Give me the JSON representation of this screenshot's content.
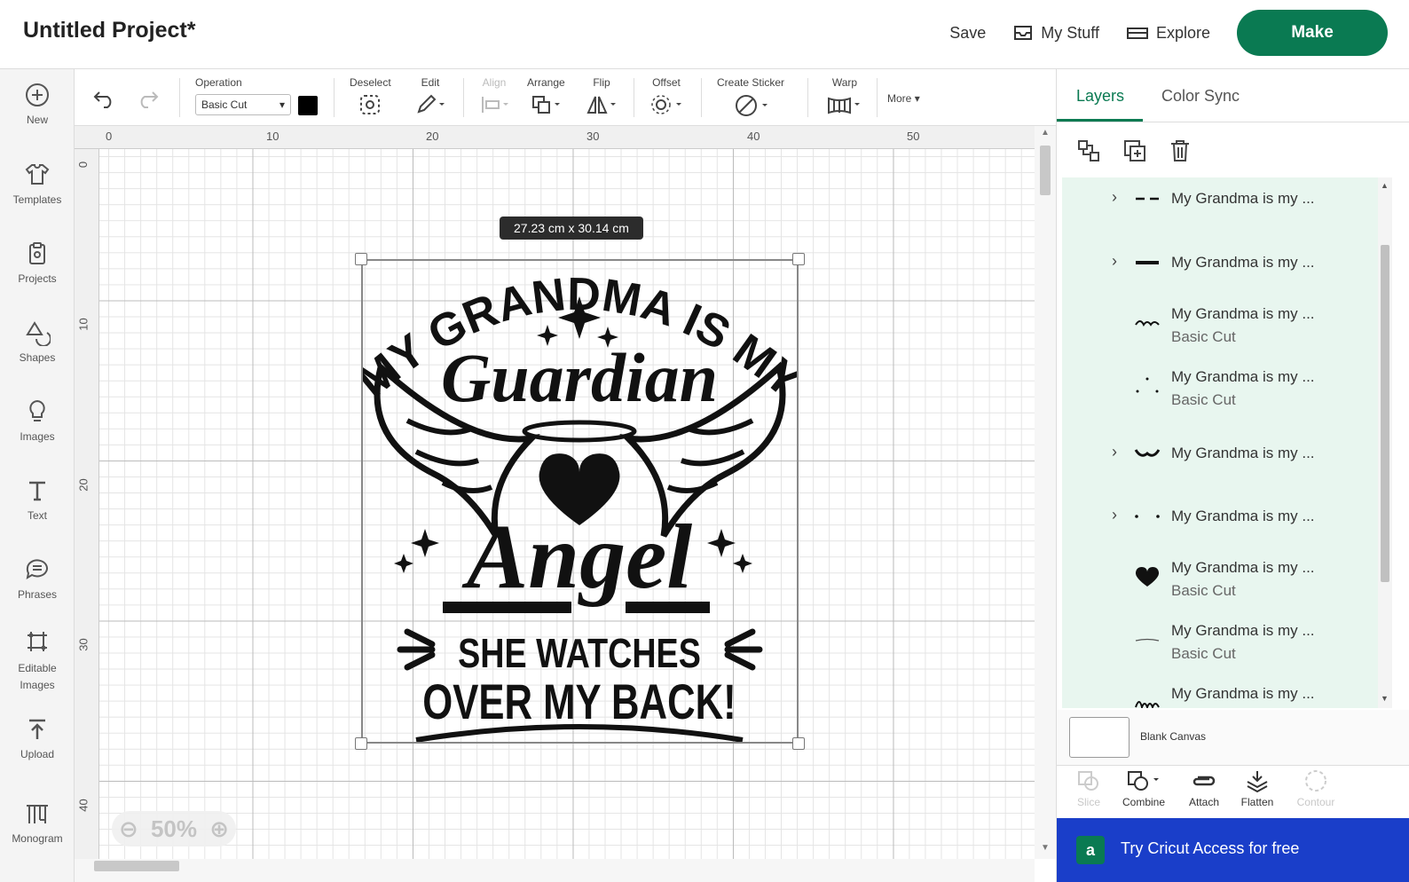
{
  "header": {
    "title": "Untitled Project*",
    "save_label": "Save",
    "my_stuff_label": "My Stuff",
    "explore_label": "Explore",
    "make_label": "Make"
  },
  "sidebar": {
    "items": [
      {
        "label": "New",
        "icon": "plus-circle-icon"
      },
      {
        "label": "Templates",
        "icon": "tshirt-icon"
      },
      {
        "label": "Projects",
        "icon": "clipboard-icon"
      },
      {
        "label": "Shapes",
        "icon": "shapes-icon"
      },
      {
        "label": "Images",
        "icon": "lightbulb-icon"
      },
      {
        "label": "Text",
        "icon": "text-icon"
      },
      {
        "label": "Phrases",
        "icon": "speech-bubble-icon"
      },
      {
        "label": "Editable\nImages",
        "icon": "editable-images-icon"
      },
      {
        "label": "Upload",
        "icon": "upload-icon"
      },
      {
        "label": "Monogram",
        "icon": "monogram-icon"
      }
    ]
  },
  "toolbar": {
    "operation_label": "Operation",
    "operation_value": "Basic Cut",
    "deselect_label": "Deselect",
    "edit_label": "Edit",
    "align_label": "Align",
    "arrange_label": "Arrange",
    "flip_label": "Flip",
    "offset_label": "Offset",
    "create_sticker_label": "Create Sticker",
    "warp_label": "Warp",
    "more_label": "More",
    "swatch_color": "#000000"
  },
  "canvas": {
    "ruler_top": [
      "0",
      "10",
      "20",
      "30",
      "40",
      "50"
    ],
    "ruler_left": [
      "0",
      "10",
      "20",
      "30",
      "40"
    ],
    "dimensions": "27.23  cm x 30.14  cm",
    "zoom": "50%",
    "design_text": {
      "line1": "MY GRANDMA IS MY",
      "line2": "Guardian",
      "line3": "Angel",
      "line4": "SHE WATCHES",
      "line5": "OVER MY BACK!"
    }
  },
  "panel": {
    "tab_layers": "Layers",
    "tab_color_sync": "Color Sync",
    "layers": [
      {
        "name": "My Grandma is my ...",
        "sub": "",
        "expandable": true,
        "thumb": "dashes"
      },
      {
        "name": "My Grandma is my ...",
        "sub": "",
        "expandable": true,
        "thumb": "bar"
      },
      {
        "name": "My Grandma is my ...",
        "sub": "Basic Cut",
        "expandable": false,
        "thumb": "guardian"
      },
      {
        "name": "My Grandma is my ...",
        "sub": "Basic Cut",
        "expandable": false,
        "thumb": "stars"
      },
      {
        "name": "My Grandma is my ...",
        "sub": "",
        "expandable": true,
        "thumb": "wings"
      },
      {
        "name": "My Grandma is my ...",
        "sub": "",
        "expandable": true,
        "thumb": "dots"
      },
      {
        "name": "My Grandma is my ...",
        "sub": "Basic Cut",
        "expandable": false,
        "thumb": "heart"
      },
      {
        "name": "My Grandma is my ...",
        "sub": "Basic Cut",
        "expandable": false,
        "thumb": "line"
      },
      {
        "name": "My Grandma is my ...",
        "sub": "",
        "expandable": false,
        "thumb": "angel"
      }
    ],
    "blank_canvas_label": "Blank Canvas",
    "bottom_tools": [
      {
        "label": "Slice",
        "disabled": true
      },
      {
        "label": "Combine",
        "disabled": false
      },
      {
        "label": "Attach",
        "disabled": false
      },
      {
        "label": "Flatten",
        "disabled": false
      },
      {
        "label": "Contour",
        "disabled": true
      }
    ],
    "access_badge": "a",
    "access_label": "Try Cricut Access for free"
  },
  "colors": {
    "brand_green": "#0a7a52",
    "access_blue": "#1a3ec9",
    "layer_highlight": "#e8f6ef"
  }
}
